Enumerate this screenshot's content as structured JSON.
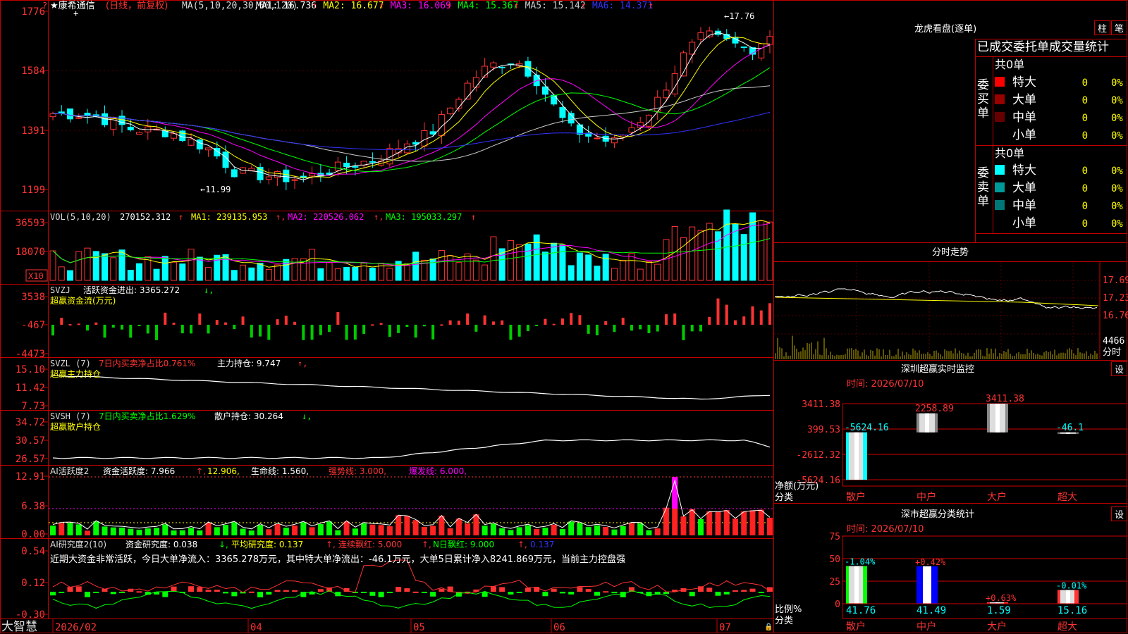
{
  "app": {
    "logo": "大智慧"
  },
  "header": {
    "stock_name": "★康希通信",
    "period_note": "(日线，前复权)",
    "ma_label": "MA(5,10,20,30,60,120)",
    "ma_values": [
      {
        "label": "MA1: 16.736",
        "color": "#ffffff"
      },
      {
        "label": "MA2: 16.677",
        "color": "#ffff00"
      },
      {
        "label": "MA3: 16.069",
        "color": "#ff00ff"
      },
      {
        "label": "MA4: 15.367",
        "color": "#00ff00"
      },
      {
        "label": "MA5: 15.142",
        "color": "#cccccc"
      },
      {
        "label": "MA6: 14.371",
        "color": "#3333ff"
      }
    ],
    "high_mark": "17.76",
    "low_mark": "11.99",
    "question_mark": "?"
  },
  "price_axis": [
    "1776",
    "1584",
    "1391",
    "1199"
  ],
  "volume": {
    "label": "VOL(5,10,20)",
    "value": "270152.312",
    "ma1": "MA1: 239135.953",
    "ma2": "MA2: 220526.062",
    "ma3": "MA3: 195033.297",
    "axis": [
      "36593",
      "18070"
    ],
    "unit": "X10"
  },
  "svzj": {
    "label": "SVZJ",
    "text": "活跃资金进出: 3365.272",
    "sub": "超赢资金流(万元)",
    "axis": [
      "3538",
      "-467",
      "-4473"
    ]
  },
  "svzl": {
    "label": "SVZL (7)",
    "text1": "7日内买卖净占比0.761%",
    "text2": "主力持仓: 9.747",
    "sub": "超赢主力持仓",
    "axis": [
      "15.10",
      "11.42",
      "7.73"
    ]
  },
  "svsh": {
    "label": "SVSH (7)",
    "text1": "7日内买卖净占比1.629%",
    "text2": "散户持仓: 30.264",
    "sub": "超赢散户持仓",
    "axis": [
      "34.72",
      "30.57",
      "26.57"
    ]
  },
  "ai_active": {
    "label": "AI活跃度2",
    "t1": "资金活跃度: 7.966",
    "t2": "12.906,",
    "t3": "生命线: 1.560,",
    "t4": "强势线: 3.000,",
    "t5": "爆发线: 6.000,",
    "axis": [
      "12.91",
      "6.38",
      "0.00"
    ]
  },
  "ai_research": {
    "label": "AI研究度2(10)",
    "t1": "资金研究度: 0.038",
    "t2": "平均研究度: 0.137",
    "t3": "连续飘红: 5.000",
    "t4": "N日飘红: 9.000",
    "t5": "0.137",
    "comment": "近期大资金非常活跃，今日大单净流入：3365.278万元，其中特大单净流出：-46.1万元，大单5日累计净入8241.869万元，当前主力控盘强",
    "axis": [
      "0.54",
      "0.12",
      "-0.30"
    ]
  },
  "time_axis": [
    "2026/02",
    "04",
    "05",
    "06",
    "07"
  ],
  "right_panel": {
    "lhb_title": "龙虎看盘(逐单)",
    "btn_bar": "柱",
    "btn_line": "笔",
    "order_title": "已成交委托单成交量统计",
    "buy_label": "委买单",
    "sell_label": "委卖单",
    "buy_total": "共0单",
    "sell_total": "共0单",
    "buy_rows": [
      {
        "name": "特大",
        "count": "0",
        "pct": "0%",
        "color": "#ff0000"
      },
      {
        "name": "大单",
        "count": "0",
        "pct": "0%",
        "color": "#990000"
      },
      {
        "name": "中单",
        "count": "0",
        "pct": "0%",
        "color": "#660000"
      },
      {
        "name": "小单",
        "count": "0",
        "pct": "0%",
        "color": ""
      }
    ],
    "sell_rows": [
      {
        "name": "特大",
        "count": "0",
        "pct": "0%",
        "color": "#00ffff"
      },
      {
        "name": "大单",
        "count": "0",
        "pct": "0%",
        "color": "#009999"
      },
      {
        "name": "中单",
        "count": "0",
        "pct": "0%",
        "color": "#007777"
      },
      {
        "name": "小单",
        "count": "0",
        "pct": "0%",
        "color": ""
      }
    ],
    "intraday_title": "分时走势",
    "intraday_axis": [
      "17.69",
      "17.23",
      "16.76"
    ],
    "intraday_vol": "4466",
    "intraday_unit": "分时",
    "sz_title": "深圳超赢实时监控",
    "sz_btn": "设",
    "sz_time": "时间: 2026/07/10",
    "sz_axis": [
      "3411.38",
      "399.53",
      "-2612.32",
      "-5624.16"
    ],
    "sz_left_label1": "净额(万元)",
    "sz_left_label2": "分类",
    "sz_bars": [
      {
        "cat": "散户",
        "value": -5624.16,
        "label": "-5624.16"
      },
      {
        "cat": "中户",
        "value": 2258.89,
        "label": "2258.89"
      },
      {
        "cat": "大户",
        "value": 3411.38,
        "label": "3411.38"
      },
      {
        "cat": "超大",
        "value": -46.1,
        "label": "-46.1"
      }
    ],
    "ss_title": "深市超赢分类统计",
    "ss_btn": "设",
    "ss_time": "时间: 2026/07/10",
    "ss_axis": [
      "75",
      "50",
      "25",
      "0"
    ],
    "ss_left_label1": "比例%",
    "ss_left_label2": "分类",
    "ss_bars": [
      {
        "cat": "散户",
        "value": 41.76,
        "label": "41.76",
        "change": "-1.04%"
      },
      {
        "cat": "中户",
        "value": 41.49,
        "label": "41.49",
        "change": "+0.42%"
      },
      {
        "cat": "大户",
        "value": 1.59,
        "label": "1.59",
        "change": "+0.63%"
      },
      {
        "cat": "超大",
        "value": 15.16,
        "label": "15.16",
        "change": "-0.01%"
      }
    ]
  }
}
